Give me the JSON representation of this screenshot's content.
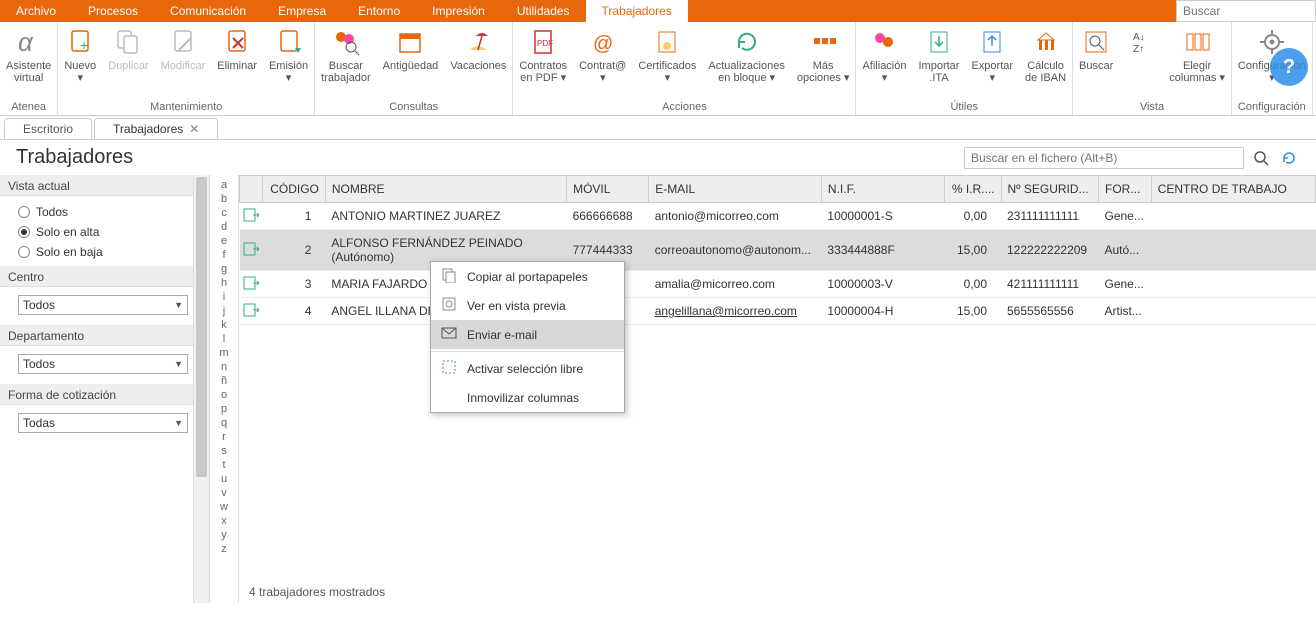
{
  "menu": {
    "items": [
      "Archivo",
      "Procesos",
      "Comunicación",
      "Empresa",
      "Entorno",
      "Impresión",
      "Utilidades",
      "Trabajadores"
    ],
    "active_index": 7,
    "search_placeholder": "Buscar"
  },
  "ribbon": {
    "groups": [
      {
        "label": "Atenea",
        "items": [
          {
            "name": "asistente-virtual",
            "label": "Asistente\nvirtual",
            "icon": "alpha"
          }
        ]
      },
      {
        "label": "Mantenimiento",
        "items": [
          {
            "name": "nuevo",
            "label": "Nuevo\n▾",
            "icon": "doc-plus"
          },
          {
            "name": "duplicar",
            "label": "Duplicar",
            "icon": "doc-copy",
            "disabled": true
          },
          {
            "name": "modificar",
            "label": "Modificar",
            "icon": "doc-edit",
            "disabled": true
          },
          {
            "name": "eliminar",
            "label": "Eliminar",
            "icon": "doc-del"
          },
          {
            "name": "emision",
            "label": "Emisión\n▾",
            "icon": "doc-print"
          }
        ]
      },
      {
        "label": "Consultas",
        "items": [
          {
            "name": "buscar-trabajador",
            "label": "Buscar\ntrabajador",
            "icon": "people-search"
          },
          {
            "name": "antiguedad",
            "label": "Antigüedad",
            "icon": "calendar"
          },
          {
            "name": "vacaciones",
            "label": "Vacaciones",
            "icon": "beach"
          }
        ]
      },
      {
        "label": "Acciones",
        "items": [
          {
            "name": "contratos-pdf",
            "label": "Contratos\nen PDF ▾",
            "icon": "pdf"
          },
          {
            "name": "contrata",
            "label": "Contrat@\n▾",
            "icon": "at"
          },
          {
            "name": "certificados",
            "label": "Certificados\n▾",
            "icon": "cert"
          },
          {
            "name": "actualizaciones",
            "label": "Actualizaciones\nen bloque ▾",
            "icon": "refresh"
          },
          {
            "name": "mas-opciones",
            "label": "Más\nopciones ▾",
            "icon": "more"
          }
        ]
      },
      {
        "label": "Útiles",
        "items": [
          {
            "name": "afiliacion",
            "label": "Afiliación\n▾",
            "icon": "afil"
          },
          {
            "name": "importar-ita",
            "label": "Importar\n.ITA",
            "icon": "import"
          },
          {
            "name": "exportar",
            "label": "Exportar\n▾",
            "icon": "export"
          },
          {
            "name": "calculo-iban",
            "label": "Cálculo\nde IBAN",
            "icon": "bank"
          }
        ]
      },
      {
        "label": "Vista",
        "items": [
          {
            "name": "buscar-vista",
            "label": "Buscar",
            "icon": "search"
          },
          {
            "name": "ordenar",
            "label": "",
            "icon": "sort",
            "small": true
          },
          {
            "name": "elegir-columnas",
            "label": "Elegir\ncolumnas ▾",
            "icon": "columns"
          }
        ]
      },
      {
        "label": "Configuración",
        "items": [
          {
            "name": "configuracion",
            "label": "Configuración\n▾",
            "icon": "gear"
          }
        ]
      }
    ]
  },
  "doc_tabs": [
    {
      "label": "Escritorio",
      "closable": false
    },
    {
      "label": "Trabajadores",
      "closable": true,
      "active": true
    }
  ],
  "page_title": "Trabajadores",
  "in_file_search_placeholder": "Buscar en el fichero (Alt+B)",
  "sidebar": {
    "vista_actual_label": "Vista actual",
    "radios": [
      {
        "label": "Todos",
        "selected": false
      },
      {
        "label": "Solo en alta",
        "selected": true
      },
      {
        "label": "Solo en baja",
        "selected": false
      }
    ],
    "centro_label": "Centro",
    "centro_value": "Todos",
    "departamento_label": "Departamento",
    "departamento_value": "Todos",
    "forma_label": "Forma de cotización",
    "forma_value": "Todas"
  },
  "az_letters": [
    "a",
    "b",
    "c",
    "d",
    "e",
    "f",
    "g",
    "h",
    "i",
    "j",
    "k",
    "l",
    "m",
    "n",
    "ñ",
    "o",
    "p",
    "q",
    "r",
    "s",
    "t",
    "u",
    "v",
    "w",
    "x",
    "y",
    "z"
  ],
  "grid": {
    "columns": [
      "CÓDIGO",
      "NOMBRE",
      "MÓVIL",
      "E-MAIL",
      "N.I.F.",
      "% I.R....",
      "Nº SEGURID...",
      "FOR...",
      "CENTRO DE TRABAJO"
    ],
    "rows": [
      {
        "codigo": "1",
        "nombre": "ANTONIO MARTINEZ JUAREZ",
        "movil": "666666688",
        "email": "antonio@micorreo.com",
        "nif": "10000001-S",
        "ir": "0,00",
        "seg": "231111111111",
        "for": "Gene...",
        "centro": ""
      },
      {
        "codigo": "2",
        "nombre": "ALFONSO FERNÁNDEZ PEINADO (Autónomo)",
        "movil": "777444333",
        "email": "correoautonomo@autonom...",
        "nif": "333444888F",
        "ir": "15,00",
        "seg": "122222222209",
        "for": "Autó...",
        "centro": "",
        "selected": true
      },
      {
        "codigo": "3",
        "nombre": "MARIA FAJARDO JUR",
        "movil": "",
        "email": "amalia@micorreo.com",
        "nif": "10000003-V",
        "ir": "0,00",
        "seg": "421111111111",
        "for": "Gene...",
        "centro": "",
        "truncated": true
      },
      {
        "codigo": "4",
        "nombre": "ANGEL ILLANA DELG",
        "movil": "",
        "email": "angelillana@micorreo.com",
        "nif": "10000004-H",
        "ir": "15,00",
        "seg": "5655565556",
        "for": "Artist...",
        "centro": "",
        "underline_email": true
      }
    ]
  },
  "context_menu": {
    "items": [
      {
        "icon": "copy",
        "label": "Copiar al portapapeles"
      },
      {
        "icon": "preview",
        "label": "Ver en vista previa"
      },
      {
        "icon": "mail",
        "label": "Enviar e-mail",
        "highlight": true
      },
      {
        "sep": true
      },
      {
        "icon": "select",
        "label": "Activar selección libre"
      },
      {
        "icon": "",
        "label": "Inmovilizar columnas"
      }
    ]
  },
  "status_text": "4 trabajadores mostrados",
  "help_bubble": "?"
}
